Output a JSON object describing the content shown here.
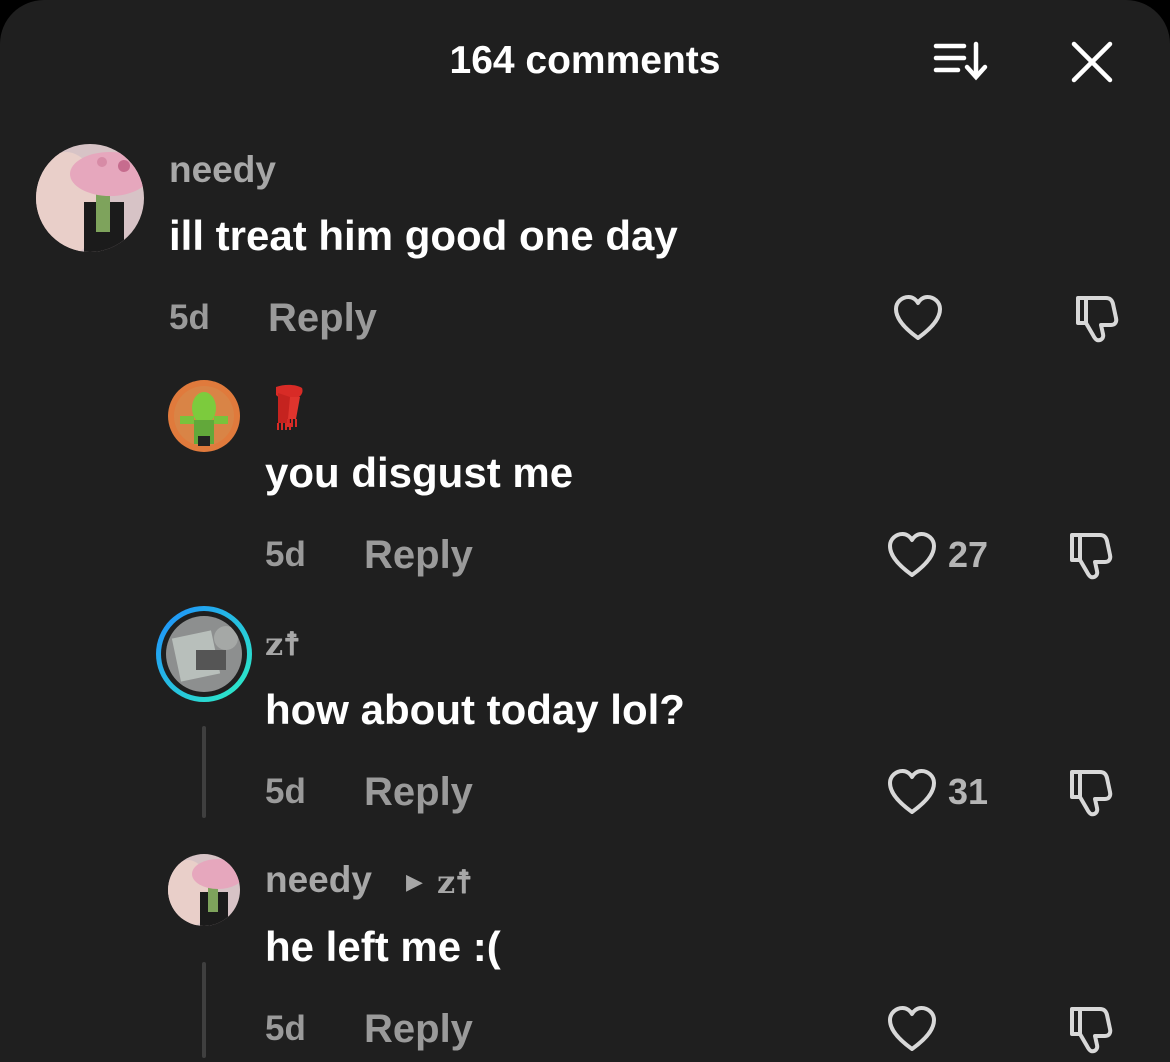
{
  "header": {
    "title": "164 comments",
    "icons": [
      "sort-icon",
      "close-icon"
    ]
  },
  "comments": [
    {
      "username": "needy",
      "text": "ill treat him good one day",
      "time": "5d",
      "reply_label": "Reply",
      "likes": ""
    },
    {
      "username_icon": "scarf-emoji",
      "text": "you disgust me",
      "time": "5d",
      "reply_label": "Reply",
      "likes": "27"
    },
    {
      "username": "z☨",
      "text": "how about today lol?",
      "time": "5d",
      "reply_label": "Reply",
      "likes": "31"
    },
    {
      "username": "needy",
      "reply_to": "z☨",
      "text": "he left me :(",
      "time": "5d",
      "reply_label": "Reply",
      "likes": ""
    }
  ],
  "colors": {
    "background": "#1f1f1f",
    "text": "#ffffff",
    "muted": "#a7a7a7",
    "story_ring_start": "#1e8bff",
    "story_ring_end": "#2ef2c2"
  }
}
